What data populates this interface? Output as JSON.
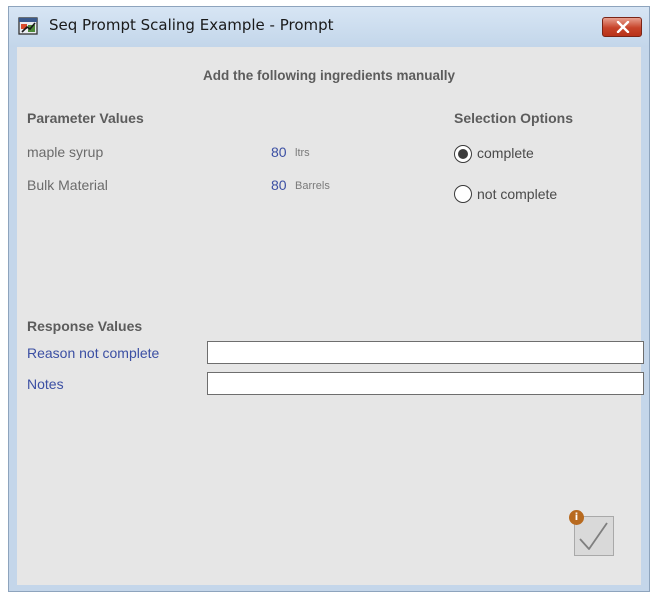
{
  "window": {
    "title": "Seq Prompt Scaling Example - Prompt",
    "close_icon": "close-x-icon",
    "app_icon": "app-window-icon"
  },
  "heading": "Add the following ingredients manually",
  "parameters": {
    "label": "Parameter Values",
    "items": [
      {
        "name": "maple syrup",
        "value": "80",
        "unit": "ltrs"
      },
      {
        "name": "Bulk Material",
        "value": "80",
        "unit": "Barrels"
      }
    ]
  },
  "selection": {
    "label": "Selection Options",
    "options": [
      {
        "label": "complete",
        "checked": true
      },
      {
        "label": "not complete",
        "checked": false
      }
    ]
  },
  "response": {
    "label": "Response Values",
    "fields": [
      {
        "label": "Reason not complete",
        "value": ""
      },
      {
        "label": "Notes",
        "value": ""
      }
    ]
  },
  "confirm": {
    "icon": "checkmark-icon",
    "badge_icon": "info-icon",
    "badge_text": "i"
  },
  "colors": {
    "titlebar": "#c4d6ea",
    "close_button": "#c7432a",
    "panel": "#e6e6e6",
    "value_text": "#3b4fa3",
    "label_text": "#5c5c5c"
  }
}
